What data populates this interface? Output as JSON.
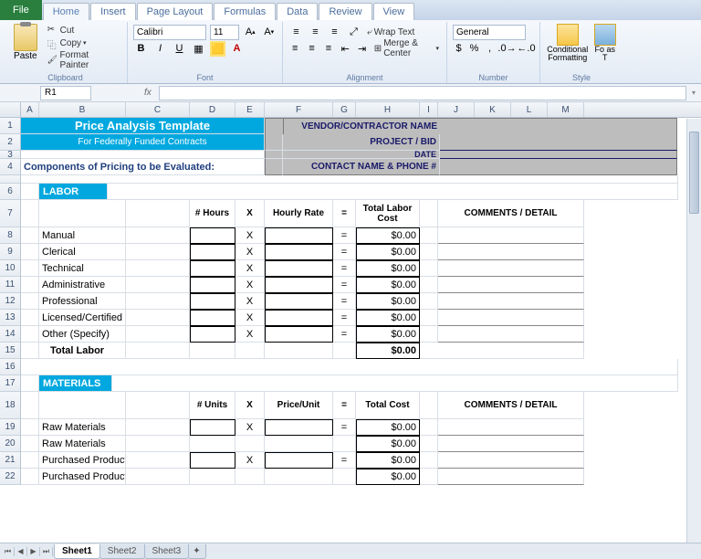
{
  "tabs": {
    "file": "File",
    "home": "Home",
    "insert": "Insert",
    "pagelayout": "Page Layout",
    "formulas": "Formulas",
    "data": "Data",
    "review": "Review",
    "view": "View"
  },
  "ribbon": {
    "clipboard": {
      "paste": "Paste",
      "cut": "Cut",
      "copy": "Copy",
      "format_painter": "Format Painter",
      "label": "Clipboard"
    },
    "font": {
      "name": "Calibri",
      "size": "11",
      "label": "Font"
    },
    "alignment": {
      "wrap": "Wrap Text",
      "merge": "Merge & Center",
      "label": "Alignment"
    },
    "number": {
      "format": "General",
      "label": "Number"
    },
    "styles": {
      "conditional": "Conditional Formatting",
      "format_as": "Fo as T",
      "label": "Style"
    }
  },
  "namebox": "R1",
  "cols": [
    "A",
    "B",
    "C",
    "D",
    "E",
    "F",
    "G",
    "H",
    "I",
    "J",
    "K",
    "L",
    "M"
  ],
  "sheet": {
    "title": "Price Analysis Template",
    "subtitle": "For Federally Funded Contracts",
    "vendor_labels": {
      "name": "VENDOR/CONTRACTOR NAME",
      "project": "PROJECT / BID",
      "date": "DATE",
      "contact": "CONTACT NAME & PHONE #"
    },
    "components": "Components of Pricing to be Evaluated:",
    "labor": {
      "section": "LABOR",
      "h_hours": "# Hours",
      "h_x": "X",
      "h_rate": "Hourly Rate",
      "h_eq": "=",
      "h_total": "Total Labor Cost",
      "comments": "COMMENTS / DETAIL",
      "rows": [
        "Manual",
        "Clerical",
        "Technical",
        "Administrative",
        "Professional",
        "Licensed/Certified",
        "Other (Specify)"
      ],
      "total_label": "Total Labor",
      "money": "$0.00"
    },
    "materials": {
      "section": "MATERIALS",
      "h_units": "# Units",
      "h_x": "X",
      "h_price": "Price/Unit",
      "h_eq": "=",
      "h_total": "Total Cost",
      "comments": "COMMENTS / DETAIL",
      "rows": [
        "Raw Materials",
        "Raw Materials",
        "Purchased Product",
        "Purchased Product"
      ],
      "money": "$0.00"
    }
  },
  "sheets": {
    "s1": "Sheet1",
    "s2": "Sheet2",
    "s3": "Sheet3"
  }
}
